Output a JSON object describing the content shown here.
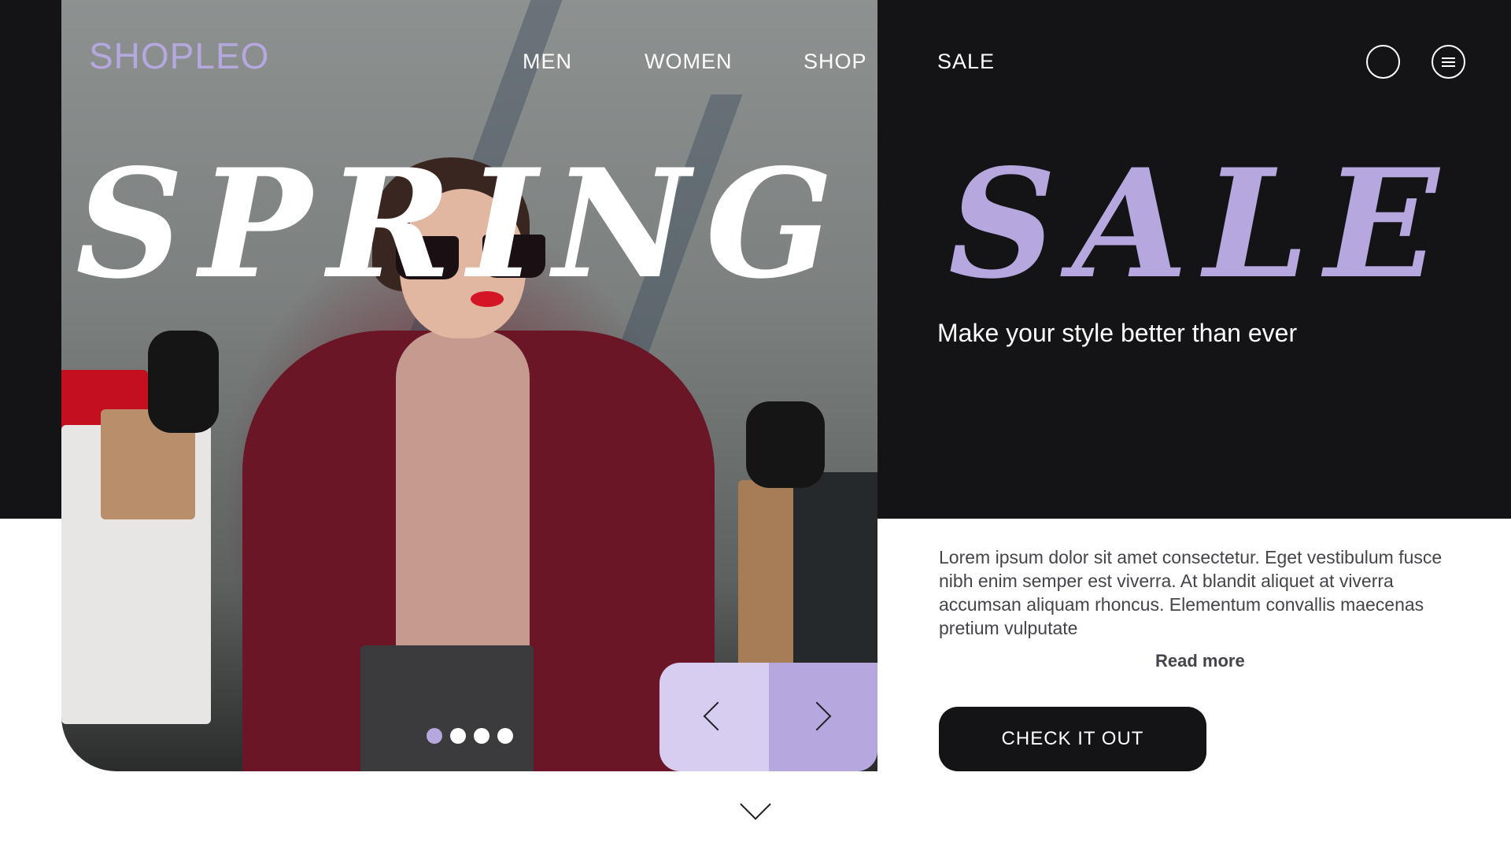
{
  "brand": {
    "logo": "SHOPLEO"
  },
  "nav": {
    "items": [
      "MEN",
      "WOMEN",
      "SHOP",
      "SALE"
    ]
  },
  "hero": {
    "word_left": "SPRING",
    "word_right": "SALE",
    "tagline": "Make your style better than ever"
  },
  "content": {
    "description": "Lorem ipsum dolor sit amet consectetur. Eget vestibulum fusce nibh enim semper est viverra. At blandit aliquet at viverra accumsan aliquam rhoncus. Elementum convallis maecenas pretium vulputate",
    "read_more": "Read more",
    "cta": "CHECK IT OUT"
  },
  "slider": {
    "total": 4,
    "active": 1
  },
  "icons": {
    "search": "search-icon",
    "menu": "menu-icon",
    "prev": "chevron-left-icon",
    "next": "chevron-right-icon",
    "scroll": "chevron-down-icon"
  },
  "colors": {
    "accent": "#b6a8df",
    "accent_light": "#d6cdf0",
    "dark": "#141417",
    "white": "#ffffff"
  }
}
